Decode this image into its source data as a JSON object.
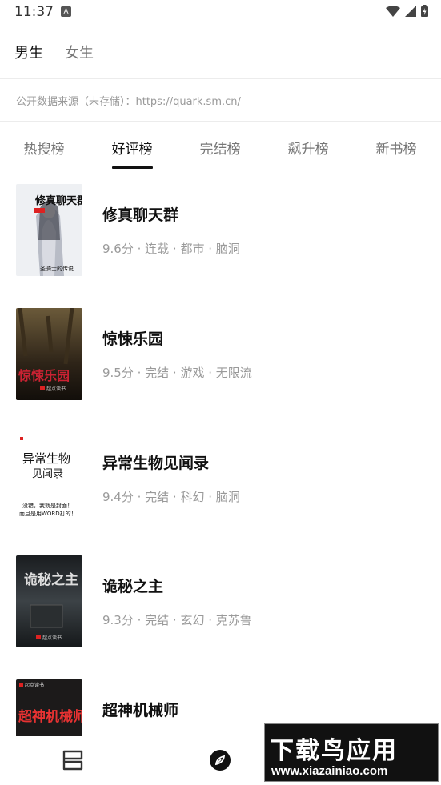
{
  "status_bar": {
    "time": "11:37",
    "notification_letter": "A"
  },
  "gender_tabs": [
    {
      "label": "男生",
      "active": true
    },
    {
      "label": "女生",
      "active": false
    }
  ],
  "source_note": "公开数据来源（未存储）：https://quark.sm.cn/",
  "rank_tabs": [
    {
      "label": "热搜榜",
      "active": false
    },
    {
      "label": "好评榜",
      "active": true
    },
    {
      "label": "完结榜",
      "active": false
    },
    {
      "label": "飙升榜",
      "active": false
    },
    {
      "label": "新书榜",
      "active": false
    }
  ],
  "books": [
    {
      "title": "修真聊天群",
      "meta": "9.6分 · 连载 · 都市 · 脑洞",
      "cover_text": "修真聊天群",
      "cover_sub": "圣骑士的传说"
    },
    {
      "title": "惊悚乐园",
      "meta": "9.5分 · 完结 · 游戏 · 无限流",
      "cover_text": "惊悚乐园",
      "cover_sub": "起点读书"
    },
    {
      "title": "异常生物见闻录",
      "meta": "9.4分 · 完结 · 科幻 · 脑洞",
      "cover_text": "异常生物",
      "cover_text2": "见闻录",
      "cover_sub": "没错，我就是封面！",
      "cover_sub2": "而且是用WORD打的！"
    },
    {
      "title": "诡秘之主",
      "meta": "9.3分 · 完结 · 玄幻 · 克苏鲁",
      "cover_text": "诡秘之主",
      "cover_sub": "起点读书"
    },
    {
      "title": "超神机械师",
      "meta": "",
      "cover_text": "超神机械师",
      "cover_sub": "起点读书"
    }
  ],
  "bottom_nav": [
    {
      "label": "",
      "icon": "bookshelf-icon"
    },
    {
      "label": "",
      "icon": "compass-icon"
    }
  ],
  "watermark": {
    "main": "下载鸟应用",
    "url": "www.xiazainiao.com"
  },
  "colors": {
    "active_text": "#111111",
    "inactive_text": "#777777",
    "meta_text": "#9a9a9a",
    "underline": "#111111"
  }
}
